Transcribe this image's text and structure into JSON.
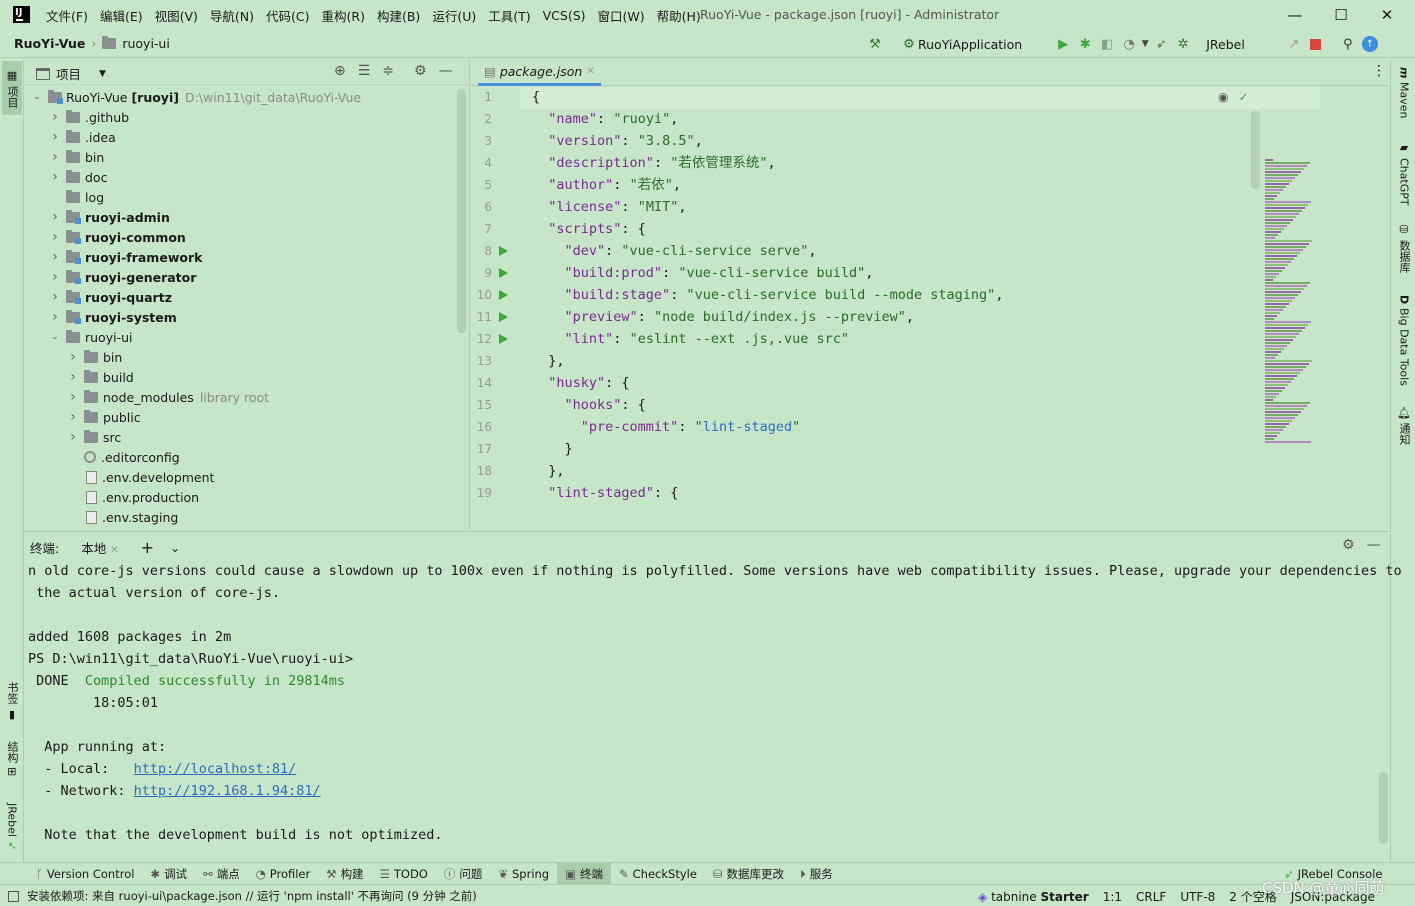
{
  "app": {
    "window_title": "RuoYi-Vue - package.json [ruoyi] - Administrator",
    "logo_text": "IJ"
  },
  "menu": [
    "文件(F)",
    "编辑(E)",
    "视图(V)",
    "导航(N)",
    "代码(C)",
    "重构(R)",
    "构建(B)",
    "运行(U)",
    "工具(T)",
    "VCS(S)",
    "窗口(W)",
    "帮助(H)"
  ],
  "breadcrumb": {
    "project": "RuoYi-Vue",
    "folder": "ruoyi-ui"
  },
  "toolbar": {
    "run_config": "RuoYiApplication",
    "jrebel": "JRebel"
  },
  "left_strip": {
    "project": "项目",
    "bookmarks": "书签",
    "structure": "结构",
    "jrebel": "JRebel"
  },
  "right_strip": {
    "maven": "Maven",
    "chatgpt": "ChatGPT",
    "database": "数据库",
    "bigdata": "Big Data Tools",
    "notifications": "通知"
  },
  "project_panel": {
    "title": "项目",
    "root": {
      "name": "RuoYi-Vue",
      "module": "[ruoyi]",
      "path": "D:\\win11\\git_data\\RuoYi-Vue"
    },
    "items": [
      {
        "name": ".github",
        "depth": 1,
        "kind": "folder",
        "bold": false,
        "expand": "closed",
        "hint": ""
      },
      {
        "name": ".idea",
        "depth": 1,
        "kind": "folder",
        "bold": false,
        "expand": "closed",
        "hint": ""
      },
      {
        "name": "bin",
        "depth": 1,
        "kind": "folder",
        "bold": false,
        "expand": "closed",
        "hint": ""
      },
      {
        "name": "doc",
        "depth": 1,
        "kind": "folder",
        "bold": false,
        "expand": "closed",
        "hint": ""
      },
      {
        "name": "log",
        "depth": 1,
        "kind": "folder",
        "bold": false,
        "expand": "none",
        "hint": ""
      },
      {
        "name": "ruoyi-admin",
        "depth": 1,
        "kind": "module",
        "bold": true,
        "expand": "closed",
        "hint": ""
      },
      {
        "name": "ruoyi-common",
        "depth": 1,
        "kind": "module",
        "bold": true,
        "expand": "closed",
        "hint": ""
      },
      {
        "name": "ruoyi-framework",
        "depth": 1,
        "kind": "module",
        "bold": true,
        "expand": "closed",
        "hint": ""
      },
      {
        "name": "ruoyi-generator",
        "depth": 1,
        "kind": "module",
        "bold": true,
        "expand": "closed",
        "hint": ""
      },
      {
        "name": "ruoyi-quartz",
        "depth": 1,
        "kind": "module",
        "bold": true,
        "expand": "closed",
        "hint": ""
      },
      {
        "name": "ruoyi-system",
        "depth": 1,
        "kind": "module",
        "bold": true,
        "expand": "closed",
        "hint": ""
      },
      {
        "name": "ruoyi-ui",
        "depth": 1,
        "kind": "folder",
        "bold": false,
        "expand": "open",
        "hint": ""
      },
      {
        "name": "bin",
        "depth": 2,
        "kind": "folder",
        "bold": false,
        "expand": "closed",
        "hint": ""
      },
      {
        "name": "build",
        "depth": 2,
        "kind": "folder",
        "bold": false,
        "expand": "closed",
        "hint": ""
      },
      {
        "name": "node_modules",
        "depth": 2,
        "kind": "folder",
        "bold": false,
        "expand": "closed",
        "hint": "library root"
      },
      {
        "name": "public",
        "depth": 2,
        "kind": "folder",
        "bold": false,
        "expand": "closed",
        "hint": ""
      },
      {
        "name": "src",
        "depth": 2,
        "kind": "folder",
        "bold": false,
        "expand": "closed",
        "hint": ""
      },
      {
        "name": ".editorconfig",
        "depth": 2,
        "kind": "gear",
        "bold": false,
        "expand": "none",
        "hint": ""
      },
      {
        "name": ".env.development",
        "depth": 2,
        "kind": "file",
        "bold": false,
        "expand": "none",
        "hint": ""
      },
      {
        "name": ".env.production",
        "depth": 2,
        "kind": "file",
        "bold": false,
        "expand": "none",
        "hint": ""
      },
      {
        "name": ".env.staging",
        "depth": 2,
        "kind": "file",
        "bold": false,
        "expand": "none",
        "hint": ""
      }
    ]
  },
  "editor": {
    "tab": "package.json",
    "run_lines": [
      8,
      9,
      10,
      11,
      12
    ],
    "lines": [
      [
        [
          "p",
          "{"
        ]
      ],
      [
        [
          "p",
          "  "
        ],
        [
          "k",
          "\"name\""
        ],
        [
          "p",
          ": "
        ],
        [
          "s",
          "\"ruoyi\""
        ],
        [
          "p",
          ","
        ]
      ],
      [
        [
          "p",
          "  "
        ],
        [
          "k",
          "\"version\""
        ],
        [
          "p",
          ": "
        ],
        [
          "s",
          "\"3.8.5\""
        ],
        [
          "p",
          ","
        ]
      ],
      [
        [
          "p",
          "  "
        ],
        [
          "k",
          "\"description\""
        ],
        [
          "p",
          ": "
        ],
        [
          "s",
          "\"若依管理系统\""
        ],
        [
          "p",
          ","
        ]
      ],
      [
        [
          "p",
          "  "
        ],
        [
          "k",
          "\"author\""
        ],
        [
          "p",
          ": "
        ],
        [
          "s",
          "\"若依\""
        ],
        [
          "p",
          ","
        ]
      ],
      [
        [
          "p",
          "  "
        ],
        [
          "k",
          "\"license\""
        ],
        [
          "p",
          ": "
        ],
        [
          "s",
          "\"MIT\""
        ],
        [
          "p",
          ","
        ]
      ],
      [
        [
          "p",
          "  "
        ],
        [
          "k",
          "\"scripts\""
        ],
        [
          "p",
          ": {"
        ]
      ],
      [
        [
          "p",
          "    "
        ],
        [
          "k",
          "\"dev\""
        ],
        [
          "p",
          ": "
        ],
        [
          "s",
          "\"vue-cli-service serve\""
        ],
        [
          "p",
          ","
        ]
      ],
      [
        [
          "p",
          "    "
        ],
        [
          "k",
          "\"build:prod\""
        ],
        [
          "p",
          ": "
        ],
        [
          "s",
          "\"vue-cli-service build\""
        ],
        [
          "p",
          ","
        ]
      ],
      [
        [
          "p",
          "    "
        ],
        [
          "k",
          "\"build:stage\""
        ],
        [
          "p",
          ": "
        ],
        [
          "s",
          "\"vue-cli-service build --mode staging\""
        ],
        [
          "p",
          ","
        ]
      ],
      [
        [
          "p",
          "    "
        ],
        [
          "k",
          "\"preview\""
        ],
        [
          "p",
          ": "
        ],
        [
          "s",
          "\"node build/index.js --preview\""
        ],
        [
          "p",
          ","
        ]
      ],
      [
        [
          "p",
          "    "
        ],
        [
          "k",
          "\"lint\""
        ],
        [
          "p",
          ": "
        ],
        [
          "s",
          "\"eslint --ext .js,.vue src\""
        ]
      ],
      [
        [
          "p",
          "  },"
        ]
      ],
      [
        [
          "p",
          "  "
        ],
        [
          "k",
          "\"husky\""
        ],
        [
          "p",
          ": {"
        ]
      ],
      [
        [
          "p",
          "    "
        ],
        [
          "k",
          "\"hooks\""
        ],
        [
          "p",
          ": {"
        ]
      ],
      [
        [
          "p",
          "      "
        ],
        [
          "k",
          "\"pre-commit\""
        ],
        [
          "p",
          ": "
        ],
        [
          "s",
          "\""
        ],
        [
          "u",
          "lint-staged"
        ],
        [
          "s",
          "\""
        ]
      ],
      [
        [
          "p",
          "    }"
        ]
      ],
      [
        [
          "p",
          "  },"
        ]
      ],
      [
        [
          "p",
          "  "
        ],
        [
          "k",
          "\"lint-staged\""
        ],
        [
          "p",
          ": {"
        ]
      ]
    ]
  },
  "terminal": {
    "label": "终端:",
    "tab": "本地",
    "lines": [
      [
        [
          "p",
          "n old core-js versions could cause a slowdown up to 100x even if nothing is polyfilled. Some versions have web compatibility issues. Please, upgrade your dependencies to"
        ]
      ],
      [
        [
          "p",
          " the actual version of core-js."
        ]
      ],
      [
        [
          "p",
          ""
        ]
      ],
      [
        [
          "p",
          "added 1608 packages in 2m"
        ]
      ],
      [
        [
          "p",
          "PS D:\\win11\\git_data\\RuoYi-Vue\\ruoyi-ui>"
        ]
      ],
      [
        [
          "p",
          " DONE  "
        ],
        [
          "g",
          "Compiled successfully in 29814ms"
        ]
      ],
      [
        [
          "p",
          "        18:05:01"
        ]
      ],
      [
        [
          "p",
          ""
        ]
      ],
      [
        [
          "p",
          "  App running at:"
        ]
      ],
      [
        [
          "p",
          "  - Local:   "
        ],
        [
          "l",
          "http://localhost:81/"
        ]
      ],
      [
        [
          "p",
          "  - Network: "
        ],
        [
          "l",
          "http://192.168.1.94:81/"
        ]
      ],
      [
        [
          "p",
          ""
        ]
      ],
      [
        [
          "p",
          "  Note that the development build is not optimized."
        ]
      ]
    ]
  },
  "bottom_tools": [
    {
      "icon": "branch-icon",
      "glyph": "ᚴ",
      "label": "Version Control",
      "active": false
    },
    {
      "icon": "debug-icon",
      "glyph": "✱",
      "label": "调试",
      "active": false
    },
    {
      "icon": "endpoints-icon",
      "glyph": "⚯",
      "label": "端点",
      "active": false
    },
    {
      "icon": "profiler-icon",
      "glyph": "◔",
      "label": "Profiler",
      "active": false
    },
    {
      "icon": "build-icon",
      "glyph": "⚒",
      "label": "构建",
      "active": false
    },
    {
      "icon": "todo-icon",
      "glyph": "☰",
      "label": "TODO",
      "active": false
    },
    {
      "icon": "problems-icon",
      "glyph": "ⓘ",
      "label": "问题",
      "active": false
    },
    {
      "icon": "spring-icon",
      "glyph": "❦",
      "label": "Spring",
      "active": false
    },
    {
      "icon": "terminal-icon",
      "glyph": "▣",
      "label": "终端",
      "active": true
    },
    {
      "icon": "checkstyle-icon",
      "glyph": "✎",
      "label": "CheckStyle",
      "active": false
    },
    {
      "icon": "db-changes-icon",
      "glyph": "⛁",
      "label": "数据库更改",
      "active": false
    },
    {
      "icon": "services-icon",
      "glyph": "⏵",
      "label": "服务",
      "active": false
    }
  ],
  "jrebel_console": "JRebel Console",
  "status": {
    "message": "安装依赖项: 来自 ruoyi-ui\\package.json // 运行 'npm install'   不再询问 (9 分钟 之前)",
    "tabnine_brand": "tabnine",
    "tabnine_plan": "Starter",
    "position": "1:1",
    "line_ending": "CRLF",
    "encoding": "UTF-8",
    "indent": "2 个空格",
    "file_type": "JSON:package",
    "watermark": "CSDN @童心同萌"
  },
  "colors": {
    "background": "#c7e5c9",
    "accent": "#4a8fd8",
    "run_green": "#3da83d",
    "json_key": "#7a2b8f",
    "json_string": "#2a6b2a"
  }
}
